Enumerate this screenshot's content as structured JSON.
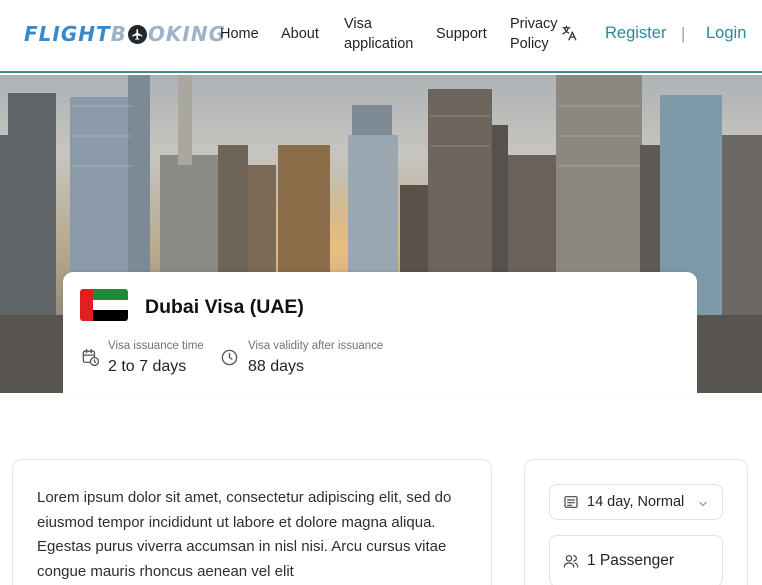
{
  "header": {
    "logo": {
      "part1": "FLIGHT",
      "part2_pre": "B",
      "part2_post": "OKING"
    },
    "nav": [
      {
        "label": "Home"
      },
      {
        "label": "About"
      },
      {
        "label_line1": "Visa",
        "label_line2": "application"
      },
      {
        "label": "Support"
      },
      {
        "label_line1": "Privacy",
        "label_line2": "Policy"
      }
    ],
    "language_icon": "translate-icon",
    "register": "Register",
    "separator": "|",
    "login": "Login"
  },
  "visa": {
    "flag": "uae-flag",
    "title": "Dubai Visa (UAE)",
    "issuance_label": "Visa issuance time",
    "issuance_value": "2 to 7 days",
    "validity_label": "Visa validity after issuance",
    "validity_value": "88 days"
  },
  "description": {
    "text": "Lorem ipsum dolor sit amet, consectetur adipiscing elit, sed do eiusmod tempor incididunt ut labore et dolore magna aliqua. Egestas purus viverra accumsan in nisl nisi. Arcu cursus vitae congue mauris rhoncus aenean vel elit"
  },
  "booking": {
    "plan": "14 day, Normal",
    "passengers": "1 Passenger"
  },
  "colors": {
    "accent": "#2a8b94",
    "logo_blue": "#3b88c9",
    "logo_grey": "#9fb3c8"
  }
}
